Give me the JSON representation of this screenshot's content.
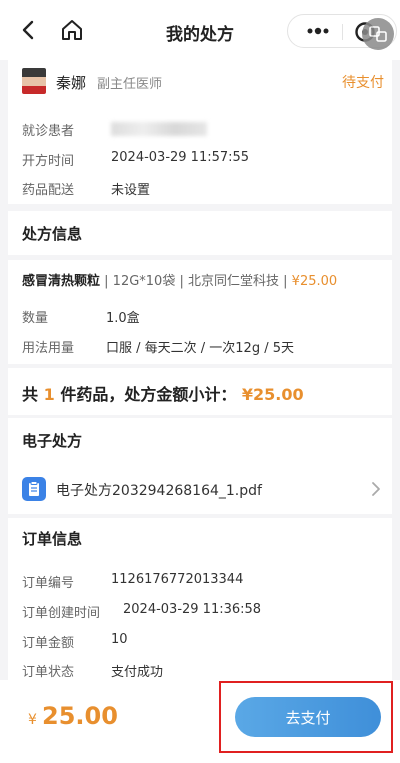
{
  "header": {
    "title": "我的处方",
    "icons": [
      "back-icon",
      "home-icon",
      "more-icon",
      "close-icon",
      "translate-icon"
    ]
  },
  "doctor": {
    "name": "秦娜",
    "title": "副主任医师",
    "status": "待支付"
  },
  "visit_info": [
    {
      "label": "就诊患者",
      "value": ""
    },
    {
      "label": "开方时间",
      "value": "2024-03-29 11:57:55"
    },
    {
      "label": "药品配送",
      "value": "未设置"
    }
  ],
  "prescription": {
    "section_title": "处方信息",
    "drug": {
      "name": "感冒清热颗粒",
      "spec": "12G*10袋",
      "maker": "北京同仁堂科技",
      "price": "¥25.00"
    },
    "details": [
      {
        "label": "数量",
        "value": "1.0盒"
      },
      {
        "label": "用法用量",
        "value": "口服 / 每天二次 / 一次12g / 5天"
      }
    ],
    "summary_prefix": "共",
    "summary_count": "1",
    "summary_mid": "件药品，处方金额小计：",
    "summary_amount": "¥25.00"
  },
  "e_prescription": {
    "section_title": "电子处方",
    "file_name": "电子处方203294268164_1.pdf"
  },
  "order": {
    "section_title": "订单信息",
    "rows": [
      {
        "label": "订单编号",
        "value": "1126176772013344"
      },
      {
        "label": "订单创建时间",
        "value": "2024-03-29 11:36:58"
      },
      {
        "label": "订单金额",
        "value": "10"
      },
      {
        "label": "订单状态",
        "value": "支付成功"
      }
    ]
  },
  "footer": {
    "currency": "¥",
    "total": "25.00",
    "pay_label": "去支付"
  },
  "colors": {
    "accent": "#e88f2e",
    "button": "#4a9be0",
    "highlight": "#e02020"
  }
}
